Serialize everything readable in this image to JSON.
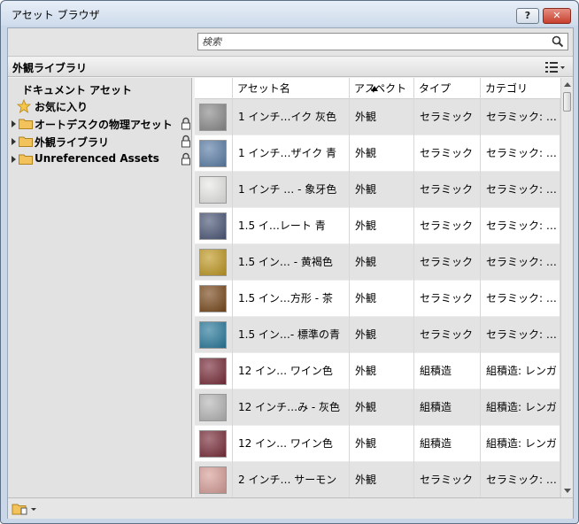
{
  "window": {
    "title": "アセット ブラウザ",
    "help_label": "?",
    "close_label": "✕"
  },
  "search": {
    "placeholder": "検索",
    "value": ""
  },
  "library": {
    "title": "外観ライブラリ"
  },
  "tree": {
    "items": [
      {
        "label": "ドキュメント アセット",
        "expandable": false,
        "icon": "none",
        "locked": false
      },
      {
        "label": "お気に入り",
        "expandable": false,
        "icon": "star-icon",
        "locked": false
      },
      {
        "label": "オートデスクの物理アセット",
        "expandable": true,
        "icon": "folder-icon",
        "locked": true
      },
      {
        "label": "外観ライブラリ",
        "expandable": true,
        "icon": "folder-icon",
        "locked": true
      },
      {
        "label": "Unreferenced Assets",
        "expandable": true,
        "icon": "folder-icon",
        "locked": true
      }
    ]
  },
  "table": {
    "columns": [
      "アセット名",
      "アスペクト",
      "タイプ",
      "カテゴリ"
    ],
    "rows": [
      {
        "name": "1 インチ…イク 灰色",
        "aspect": "外観",
        "type": "セラミック",
        "category": "セラミック: …",
        "swatch": "#8c8c8c"
      },
      {
        "name": "1 インチ…ザイク 青",
        "aspect": "外観",
        "type": "セラミック",
        "category": "セラミック: …",
        "swatch": "#5d7fa8"
      },
      {
        "name": "1 インチ … - 象牙色",
        "aspect": "外観",
        "type": "セラミック",
        "category": "セラミック: …",
        "swatch": "#e9e9e7"
      },
      {
        "name": "1.5 イ…レート 青",
        "aspect": "外観",
        "type": "セラミック",
        "category": "セラミック: …",
        "swatch": "#4c5878"
      },
      {
        "name": "1.5 イン… - 黄褐色",
        "aspect": "外観",
        "type": "セラミック",
        "category": "セラミック: …",
        "swatch": "#c19a25"
      },
      {
        "name": "1.5 イン…方形 - 茶",
        "aspect": "外観",
        "type": "セラミック",
        "category": "セラミック: …",
        "swatch": "#7a4a1d"
      },
      {
        "name": "1.5 イン…- 標準の青",
        "aspect": "外観",
        "type": "セラミック",
        "category": "セラミック: …",
        "swatch": "#2a7a9c"
      },
      {
        "name": "12 イン… ワイン色",
        "aspect": "外観",
        "type": "組積造",
        "category": "組積造: レンガ",
        "swatch": "#7a2e3b"
      },
      {
        "name": "12 インチ…み - 灰色",
        "aspect": "外観",
        "type": "組積造",
        "category": "組積造: レンガ",
        "swatch": "#b7b7b7"
      },
      {
        "name": "12 イン… ワイン色",
        "aspect": "外観",
        "type": "組積造",
        "category": "組積造: レンガ",
        "swatch": "#7a2e3b"
      },
      {
        "name": "2 インチ… サーモン",
        "aspect": "外観",
        "type": "セラミック",
        "category": "セラミック: …",
        "swatch": "#d9a09a"
      }
    ]
  },
  "colors": {
    "window_border": "#5d6f84",
    "row_alt": "#e3e3e3"
  }
}
